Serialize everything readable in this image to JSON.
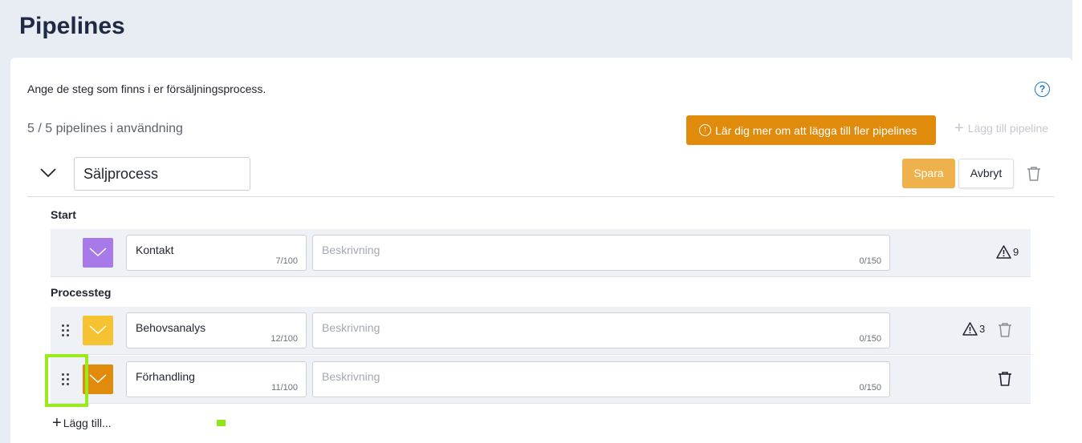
{
  "page": {
    "title": "Pipelines"
  },
  "intro": {
    "text": "Ange de steg som finns i er försäljningsprocess."
  },
  "usage": {
    "text": "5 / 5 pipelines i användning"
  },
  "actions": {
    "learn_more": "Lär dig mer om att lägga till fler pipelines",
    "add_pipeline": "Lägg till pipeline"
  },
  "pipeline": {
    "name": "Säljprocess",
    "save": "Spara",
    "cancel": "Avbryt"
  },
  "sections": {
    "start": "Start",
    "process": "Processteg"
  },
  "steps": [
    {
      "name": "Kontakt",
      "counter": "7/100",
      "desc_placeholder": "Beskrivning",
      "desc_counter": "0/150",
      "color": "#a779e9",
      "warnings": "9"
    },
    {
      "name": "Behovsanalys",
      "counter": "12/100",
      "desc_placeholder": "Beskrivning",
      "desc_counter": "0/150",
      "color": "#f5c232",
      "warnings": "3"
    },
    {
      "name": "Förhandling",
      "counter": "11/100",
      "desc_placeholder": "Beskrivning",
      "desc_counter": "0/150",
      "color": "#e08b0b",
      "warnings": ""
    }
  ],
  "add_step": {
    "label": "Lägg till..."
  },
  "icons": {
    "help": "help-circle-icon",
    "collapse": "chevron-down-icon",
    "trash": "trash-icon",
    "warning": "warning-triangle-icon",
    "drag": "drag-handle-icon",
    "upload": "arrow-up-circle-icon"
  },
  "colors": {
    "accent": "#e08b0b",
    "save_disabled": "#eeb14b",
    "help": "#1a73c8",
    "focus": "#9bea1e"
  }
}
